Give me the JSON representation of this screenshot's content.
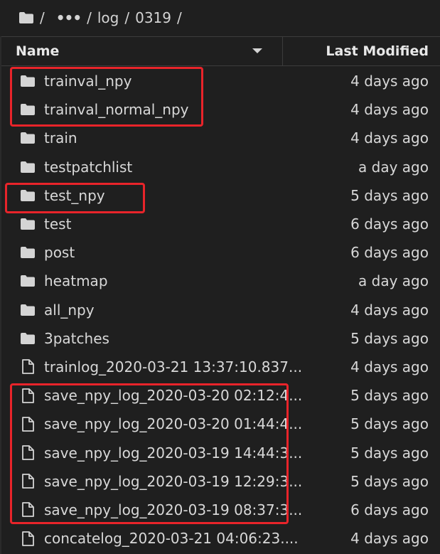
{
  "breadcrumb": {
    "icon": "folder-icon",
    "segments": [
      "/",
      "•••",
      "/",
      "log",
      "/",
      "0319",
      "/"
    ]
  },
  "header": {
    "name_label": "Name",
    "modified_label": "Last Modified"
  },
  "files": [
    {
      "type": "folder",
      "name": "trainval_npy",
      "modified": "4 days ago"
    },
    {
      "type": "folder",
      "name": "trainval_normal_npy",
      "modified": "4 days ago"
    },
    {
      "type": "folder",
      "name": "train",
      "modified": "4 days ago"
    },
    {
      "type": "folder",
      "name": "testpatchlist",
      "modified": "a day ago"
    },
    {
      "type": "folder",
      "name": "test_npy",
      "modified": "5 days ago"
    },
    {
      "type": "folder",
      "name": "test",
      "modified": "6 days ago"
    },
    {
      "type": "folder",
      "name": "post",
      "modified": "6 days ago"
    },
    {
      "type": "folder",
      "name": "heatmap",
      "modified": "a day ago"
    },
    {
      "type": "folder",
      "name": "all_npy",
      "modified": "4 days ago"
    },
    {
      "type": "folder",
      "name": "3patches",
      "modified": "5 days ago"
    },
    {
      "type": "file",
      "name": "trainlog_2020-03-21 13:37:10.837...",
      "modified": "4 days ago"
    },
    {
      "type": "file",
      "name": "save_npy_log_2020-03-20 02:12:4...",
      "modified": "5 days ago"
    },
    {
      "type": "file",
      "name": "save_npy_log_2020-03-20 01:44:4...",
      "modified": "5 days ago"
    },
    {
      "type": "file",
      "name": "save_npy_log_2020-03-19 14:44:3...",
      "modified": "5 days ago"
    },
    {
      "type": "file",
      "name": "save_npy_log_2020-03-19 12:29:3...",
      "modified": "5 days ago"
    },
    {
      "type": "file",
      "name": "save_npy_log_2020-03-19 08:37:3...",
      "modified": "6 days ago"
    },
    {
      "type": "file",
      "name": "concatelog_2020-03-21 04:06:23....",
      "modified": "4 days ago"
    }
  ],
  "colors": {
    "background": "#1f1f1f",
    "text": "#d8d8d8",
    "highlight": "#e8242a",
    "icon": "#d4d4d4"
  }
}
